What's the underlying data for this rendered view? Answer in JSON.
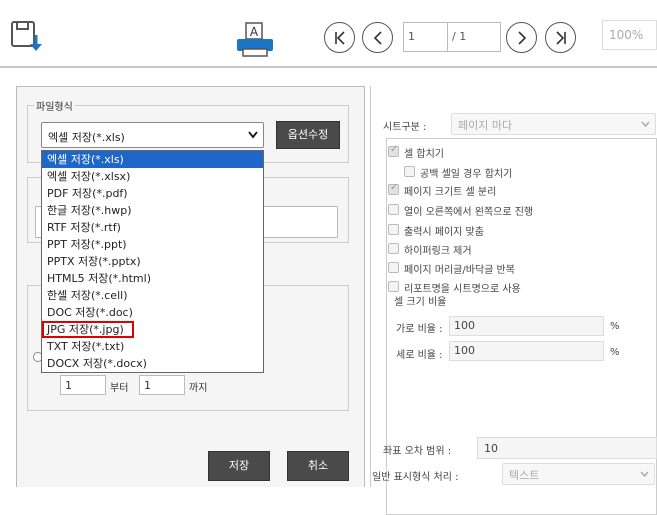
{
  "toolbar": {
    "page_current": "1",
    "page_total": "/ 1",
    "zoom": "100%"
  },
  "left": {
    "file_format_legend": "파일형식",
    "format_select_value": "엑셀 저장(*.xls)",
    "options_button": "옵션수정",
    "dropdown_options": [
      "엑셀 저장(*.xls)",
      "엑셀 저장(*.xlsx)",
      "PDF 저장(*.pdf)",
      "한글 저장(*.hwp)",
      "RTF 저장(*.rtf)",
      "PPT 저장(*.ppt)",
      "PPTX 저장(*.pptx)",
      "HTML5 저장(*.html)",
      "한셀 저장(*.cell)",
      "DOC 저장(*.doc)",
      "JPG 저장(*.jpg)",
      "TXT 저장(*.txt)",
      "DOCX 저장(*.docx)"
    ],
    "selected_index": 0,
    "highlighted_index": 10,
    "range_from": "1",
    "range_from_label": "부터",
    "range_to": "1",
    "range_to_label": "까지",
    "save_button": "저장",
    "cancel_button": "취소"
  },
  "right": {
    "sheet_split_label": "시트구분 :",
    "sheet_split_value": "페이지 마다",
    "checks": [
      {
        "label": "셀 합치기",
        "checked": true
      },
      {
        "label": "공백 셀일 경우 합치기",
        "checked": false
      },
      {
        "label": "페이지 크기트 셀 분리",
        "checked": true
      },
      {
        "label": "열이 오른쪽에서 왼쪽으로 진행",
        "checked": false
      },
      {
        "label": "출력시 페이지 맞춤",
        "checked": false
      },
      {
        "label": "하이퍼링크 제거",
        "checked": false
      },
      {
        "label": "페이지 머리글/바닥글 반복",
        "checked": false
      },
      {
        "label": "리포트명을 시트명으로 사용",
        "checked": false
      }
    ],
    "cell_size_legend": "셀 크기 비율",
    "width_ratio_label": "가로 비율 :",
    "width_ratio_value": "100",
    "height_ratio_label": "세로 비율 :",
    "height_ratio_value": "100",
    "percent_unit": "%",
    "coord_tolerance_label": "좌표 오차 범위 :",
    "coord_tolerance_value": "10",
    "format_handling_label": "일반 표시형식 처리 :",
    "format_handling_value": "텍스트"
  },
  "colors": {
    "selected_option_bg": "#1e66c8",
    "highlight_outline": "#e00000",
    "dark_button": "#4a4a4a"
  }
}
